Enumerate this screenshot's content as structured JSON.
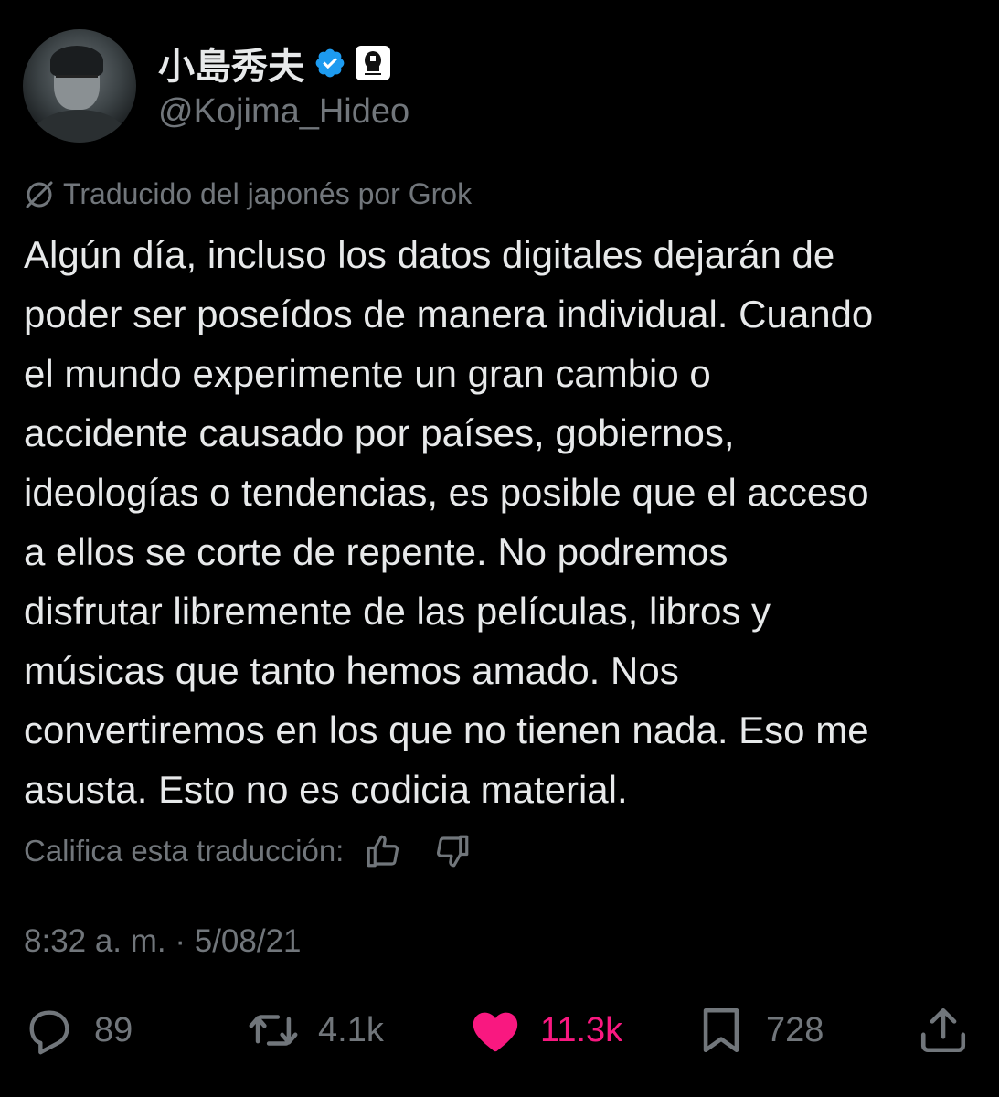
{
  "author": {
    "display_name": "小島秀夫",
    "handle": "@Kojima_Hideo",
    "verified_color": "#1d9bf0"
  },
  "translation_notice": "Traducido del japonés por Grok",
  "tweet_lines": [
    "Algún día, incluso los datos digitales dejarán de",
    "poder ser poseídos de manera individual. Cuando",
    "el mundo experimente un gran cambio o",
    "accidente causado por países, gobiernos,",
    "ideologías o tendencias, es posible que el acceso",
    "a ellos se corte de repente. No podremos",
    "disfrutar libremente de las películas, libros y",
    "músicas que tanto hemos amado. Nos",
    "convertiremos en los que no tienen nada. Eso me",
    "asusta. Esto no es codicia material."
  ],
  "rate_label": "Califica esta traducción:",
  "timestamp": "8:32 a. m. · 5/08/21",
  "actions": {
    "replies": "89",
    "retweets": "4.1k",
    "likes": "11.3k",
    "bookmarks": "728"
  },
  "colors": {
    "background": "#000000",
    "text": "#e7e9ea",
    "muted": "#71767b",
    "like": "#f91880"
  }
}
